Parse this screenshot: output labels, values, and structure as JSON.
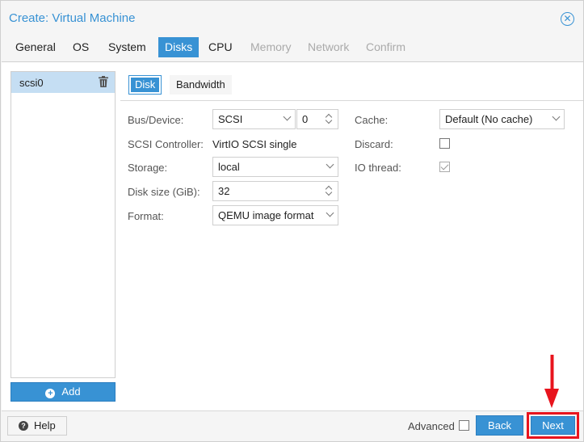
{
  "window": {
    "title": "Create: Virtual Machine"
  },
  "tabs": [
    {
      "label": "General",
      "state": "enabled"
    },
    {
      "label": "OS",
      "state": "enabled"
    },
    {
      "label": "System",
      "state": "enabled"
    },
    {
      "label": "Disks",
      "state": "active"
    },
    {
      "label": "CPU",
      "state": "enabled"
    },
    {
      "label": "Memory",
      "state": "disabled"
    },
    {
      "label": "Network",
      "state": "disabled"
    },
    {
      "label": "Confirm",
      "state": "disabled"
    }
  ],
  "disk_list": {
    "items": [
      {
        "label": "scsi0"
      }
    ],
    "add_label": "Add"
  },
  "subtabs": [
    {
      "label": "Disk",
      "active": true
    },
    {
      "label": "Bandwidth",
      "active": false
    }
  ],
  "form": {
    "bus_device": {
      "label": "Bus/Device:",
      "bus": "SCSI",
      "device": "0"
    },
    "scsi_controller": {
      "label": "SCSI Controller:",
      "value": "VirtIO SCSI single"
    },
    "storage": {
      "label": "Storage:",
      "value": "local"
    },
    "disk_size": {
      "label": "Disk size (GiB):",
      "value": "32"
    },
    "format": {
      "label": "Format:",
      "value": "QEMU image format"
    },
    "cache": {
      "label": "Cache:",
      "value": "Default (No cache)"
    },
    "discard": {
      "label": "Discard:",
      "checked": false
    },
    "io_thread": {
      "label": "IO thread:",
      "checked": true
    }
  },
  "footer": {
    "help_label": "Help",
    "advanced_label": "Advanced",
    "advanced_checked": false,
    "back_label": "Back",
    "next_label": "Next"
  },
  "colors": {
    "accent": "#3892d4",
    "highlight": "#e8141d",
    "selected_row": "#c5def3"
  },
  "icons": [
    "close-icon",
    "trash-icon",
    "plus-icon",
    "help-icon",
    "chevron-down-icon",
    "spinner-icon",
    "check-icon",
    "arrow-down-icon"
  ]
}
